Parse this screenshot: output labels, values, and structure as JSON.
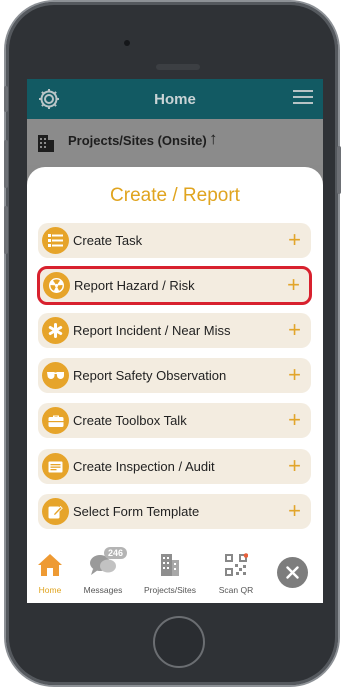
{
  "header": {
    "title": "Home"
  },
  "projects_bar": {
    "label": "Projects/Sites (Onsite)"
  },
  "sheet": {
    "title": "Create / Report",
    "items": [
      {
        "label": "Create Task",
        "icon": "list-icon"
      },
      {
        "label": "Report Hazard / Risk",
        "icon": "hazard-icon"
      },
      {
        "label": "Report Incident / Near Miss",
        "icon": "asterisk-icon"
      },
      {
        "label": "Report Safety Observation",
        "icon": "glasses-icon"
      },
      {
        "label": "Create Toolbox Talk",
        "icon": "toolbox-icon"
      },
      {
        "label": "Create Inspection / Audit",
        "icon": "inspection-icon"
      },
      {
        "label": "Select Form Template",
        "icon": "form-template-icon"
      }
    ],
    "plus": "+"
  },
  "tabbar": {
    "home": "Home",
    "messages": "Messages",
    "messages_badge": "246",
    "projects": "Projects/Sites",
    "scan": "Scan QR"
  },
  "colors": {
    "accent": "#e0a41f",
    "header": "#125a63",
    "highlight": "#d8212e"
  }
}
